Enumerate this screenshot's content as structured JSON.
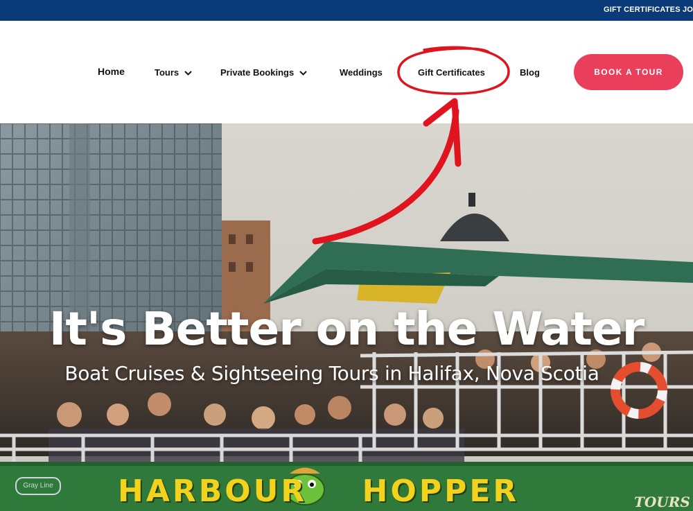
{
  "topbar": {
    "gift_certificates": "GIFT CERTIFICATES",
    "join": "JOI"
  },
  "nav": {
    "home": "Home",
    "tours": "Tours",
    "private_bookings": "Private Bookings",
    "weddings": "Weddings",
    "gift_certificates": "Gift Certificates",
    "blog": "Blog",
    "book_tour": "BOOK A TOUR"
  },
  "hero": {
    "title": "It's Better on the Water",
    "subtitle": "Boat Cruises & Sightseeing Tours in Halifax, Nova Scotia",
    "boat_name": "HARBOUR HOPPER",
    "boat_side_label": "TOURS",
    "gray_line_badge": "Gray Line"
  },
  "colors": {
    "topbar": "#0b3a78",
    "accent": "#ea3f5a",
    "annotation": "#e0141e",
    "boat_green": "#2f7a3b",
    "boat_text": "#f2d21c"
  },
  "icons": {
    "tours_chevron": "chevron-down-icon",
    "private_chevron": "chevron-down-icon",
    "annotation_circle": "circle-highlight",
    "annotation_arrow": "curved-arrow-icon"
  }
}
